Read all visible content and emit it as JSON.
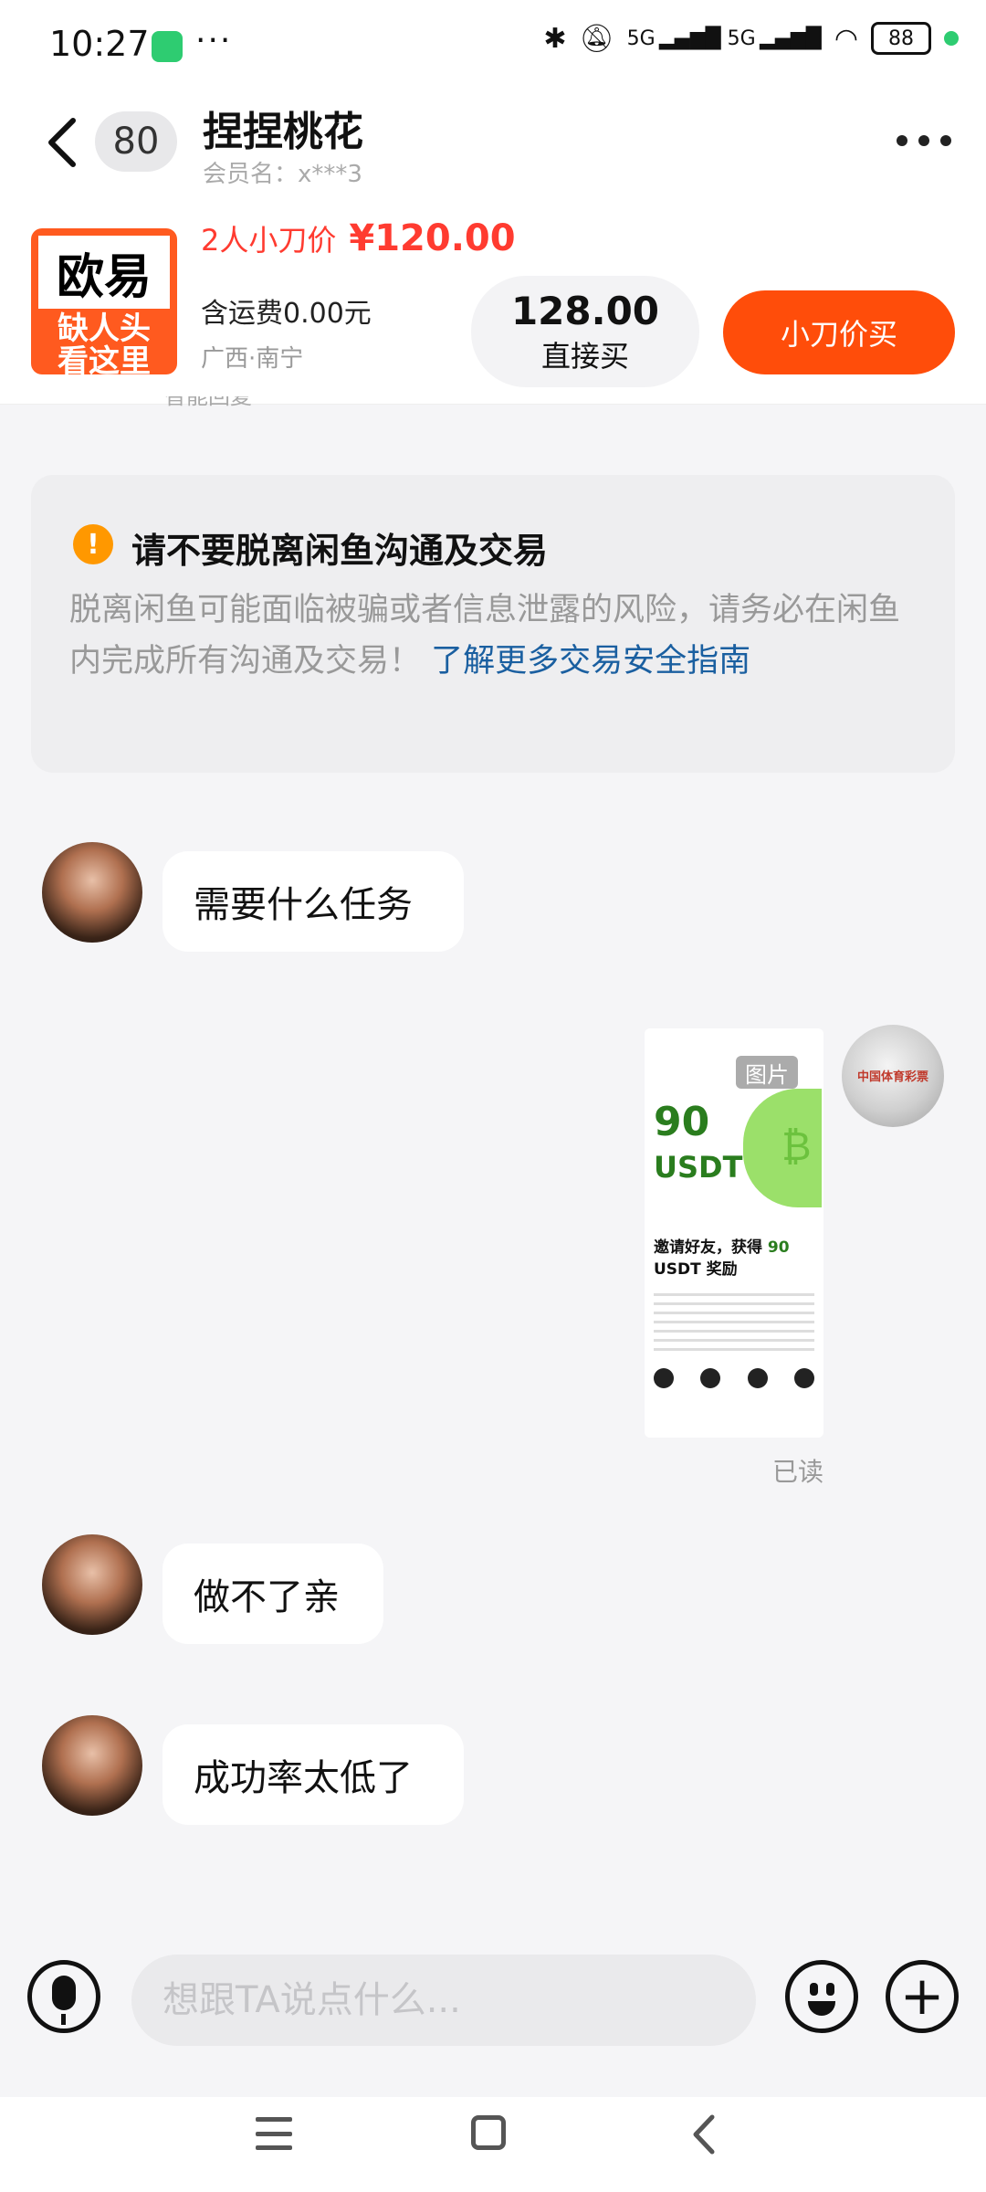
{
  "status_bar": {
    "time": "10:27",
    "more": "···",
    "signal": "5G ▂▄▆█ 5G ▂▄▆█",
    "battery": "88"
  },
  "header": {
    "unread_count": "80",
    "seller_name": "捏捏桃花",
    "member_id": "会员名：x***3"
  },
  "product": {
    "thumb_top": "欧易",
    "thumb_bottom": "缺人头\n看这里",
    "price_label": "2人小刀价",
    "price_value": "¥120.00",
    "shipping": "含运费0.00元",
    "location": "广西·南宁",
    "direct_price": "128.00",
    "direct_label": "直接买",
    "cut_buy_label": "小刀价买",
    "peek_text": "智能回复"
  },
  "warning": {
    "icon": "!",
    "title": "请不要脱离闲鱼沟通及交易",
    "body": "脱离闲鱼可能面临被骗或者信息泄露的风险，请务必在闲鱼内完成所有沟通及交易！ ",
    "link": "了解更多交易安全指南"
  },
  "messages": [
    {
      "text": "需要什么任务"
    },
    {
      "image": {
        "tag": "图片",
        "big_number": "90",
        "big_unit": "USDT",
        "btc_glyph": "₿",
        "sub_line1": "邀请好友，获得",
        "sub_highlight": "90",
        "sub_line2": "USDT 奖励"
      },
      "avatar_text": "中国体育彩票",
      "read_status": "已读"
    },
    {
      "text": "做不了亲"
    },
    {
      "text": "成功率太低了"
    }
  ],
  "input": {
    "placeholder": "想跟TA说点什么..."
  },
  "colors": {
    "accent": "#ff4d0a",
    "price_red": "#ff3b30",
    "link_blue": "#1a5fa0",
    "warning_orange": "#ff9800"
  }
}
